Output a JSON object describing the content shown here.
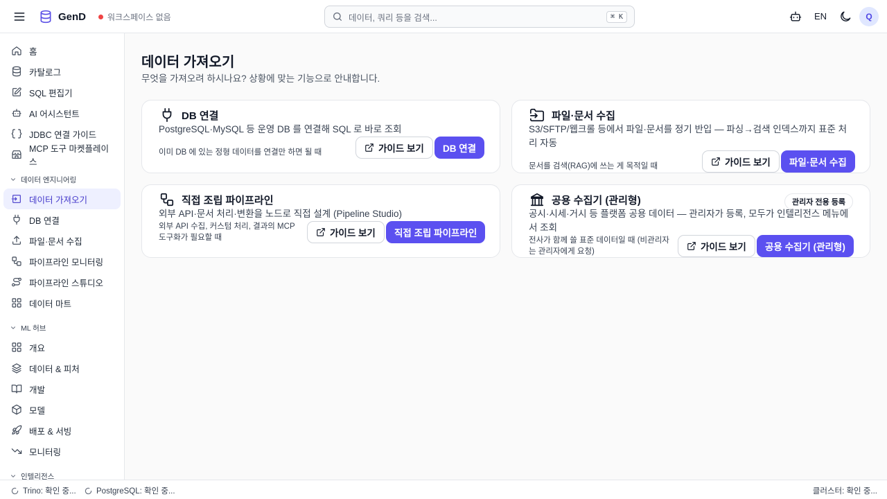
{
  "header": {
    "brand": "GenD",
    "workspace": "워크스페이스 없음",
    "search_placeholder": "데이터, 쿼리 등을 검색...",
    "shortcut": "⌘ K",
    "lang": "EN",
    "avatar_initial": "Q"
  },
  "sidebar": {
    "top_items": [
      {
        "label": "홈",
        "icon": "home-icon"
      },
      {
        "label": "카탈로그",
        "icon": "database-icon"
      },
      {
        "label": "SQL 편집기",
        "icon": "edit-icon"
      },
      {
        "label": "AI 어시스턴트",
        "icon": "bot-icon"
      },
      {
        "label": "JDBC 연결 가이드",
        "icon": "code-icon"
      },
      {
        "label": "MCP 도구 마켓플레이스",
        "icon": "store-icon"
      }
    ],
    "sections": [
      {
        "label": "데이터 엔지니어링",
        "items": [
          {
            "label": "데이터 가져오기",
            "icon": "import-icon",
            "active": true
          },
          {
            "label": "DB 연결",
            "icon": "plug-icon"
          },
          {
            "label": "파일·문서 수집",
            "icon": "upload-icon"
          },
          {
            "label": "파이프라인 모니터링",
            "icon": "workflow-icon"
          },
          {
            "label": "파이프라인 스튜디오",
            "icon": "route-icon"
          },
          {
            "label": "데이터 마트",
            "icon": "grid-icon"
          }
        ]
      },
      {
        "label": "ML 허브",
        "items": [
          {
            "label": "개요",
            "icon": "grid-icon"
          },
          {
            "label": "데이터 & 피처",
            "icon": "layers-icon"
          },
          {
            "label": "개발",
            "icon": "book-icon"
          },
          {
            "label": "모델",
            "icon": "box-icon"
          },
          {
            "label": "배포 & 서빙",
            "icon": "rocket-icon"
          },
          {
            "label": "모니터링",
            "icon": "trend-icon"
          }
        ]
      },
      {
        "label": "인텔리전스",
        "items": []
      }
    ]
  },
  "main": {
    "title": "데이터 가져오기",
    "subtitle": "무엇을 가져오려 하시나요? 상황에 맞는 기능으로 안내합니다.",
    "cards": [
      {
        "title": "DB 연결",
        "icon": "plug-icon",
        "desc": "PostgreSQL·MySQL 등 운영 DB 를 연결해 SQL 로 바로 조회",
        "note": "이미 DB 에 있는 정형 데이터를 연결만 하면 될 때",
        "guide": "가이드 보기",
        "action": "DB 연결"
      },
      {
        "title": "파일·문서 수집",
        "icon": "folder-input-icon",
        "desc": "S3/SFTP/웹크롤 등에서 파일·문서를 정기 반입 — 파싱→검색 인덱스까지 표준 처리 자동",
        "note": "문서를 검색(RAG)에 쓰는 게 목적일 때",
        "guide": "가이드 보기",
        "action": "파일·문서 수집"
      },
      {
        "title": "직접 조립 파이프라인",
        "icon": "workflow-icon",
        "desc": "외부 API·문서 처리·변환을 노드로 직접 설계 (Pipeline Studio)",
        "note": "외부 API 수집, 커스텀 처리, 결과의 MCP 도구화가 필요할 때",
        "guide": "가이드 보기",
        "action": "직접 조립 파이프라인"
      },
      {
        "title": "공용 수집기 (관리형)",
        "icon": "landmark-icon",
        "badge": "관리자 전용 등록",
        "desc": "공시·시세·거시 등 플랫폼 공용 데이터 — 관리자가 등록, 모두가 인텔리전스 메뉴에서 조회",
        "note": "전사가 함께 쓸 표준 데이터일 때 (비관리자는 관리자에게 요청)",
        "guide": "가이드 보기",
        "action": "공용 수집기 (관리형)"
      }
    ]
  },
  "footer": {
    "trino": "Trino: 확인 중...",
    "postgres": "PostgreSQL: 확인 중...",
    "cluster": "클러스터: 확인 중..."
  },
  "colors": {
    "accent": "#5b50f0",
    "active_bg": "#eef0ff",
    "status_dot": "#ef4444"
  }
}
